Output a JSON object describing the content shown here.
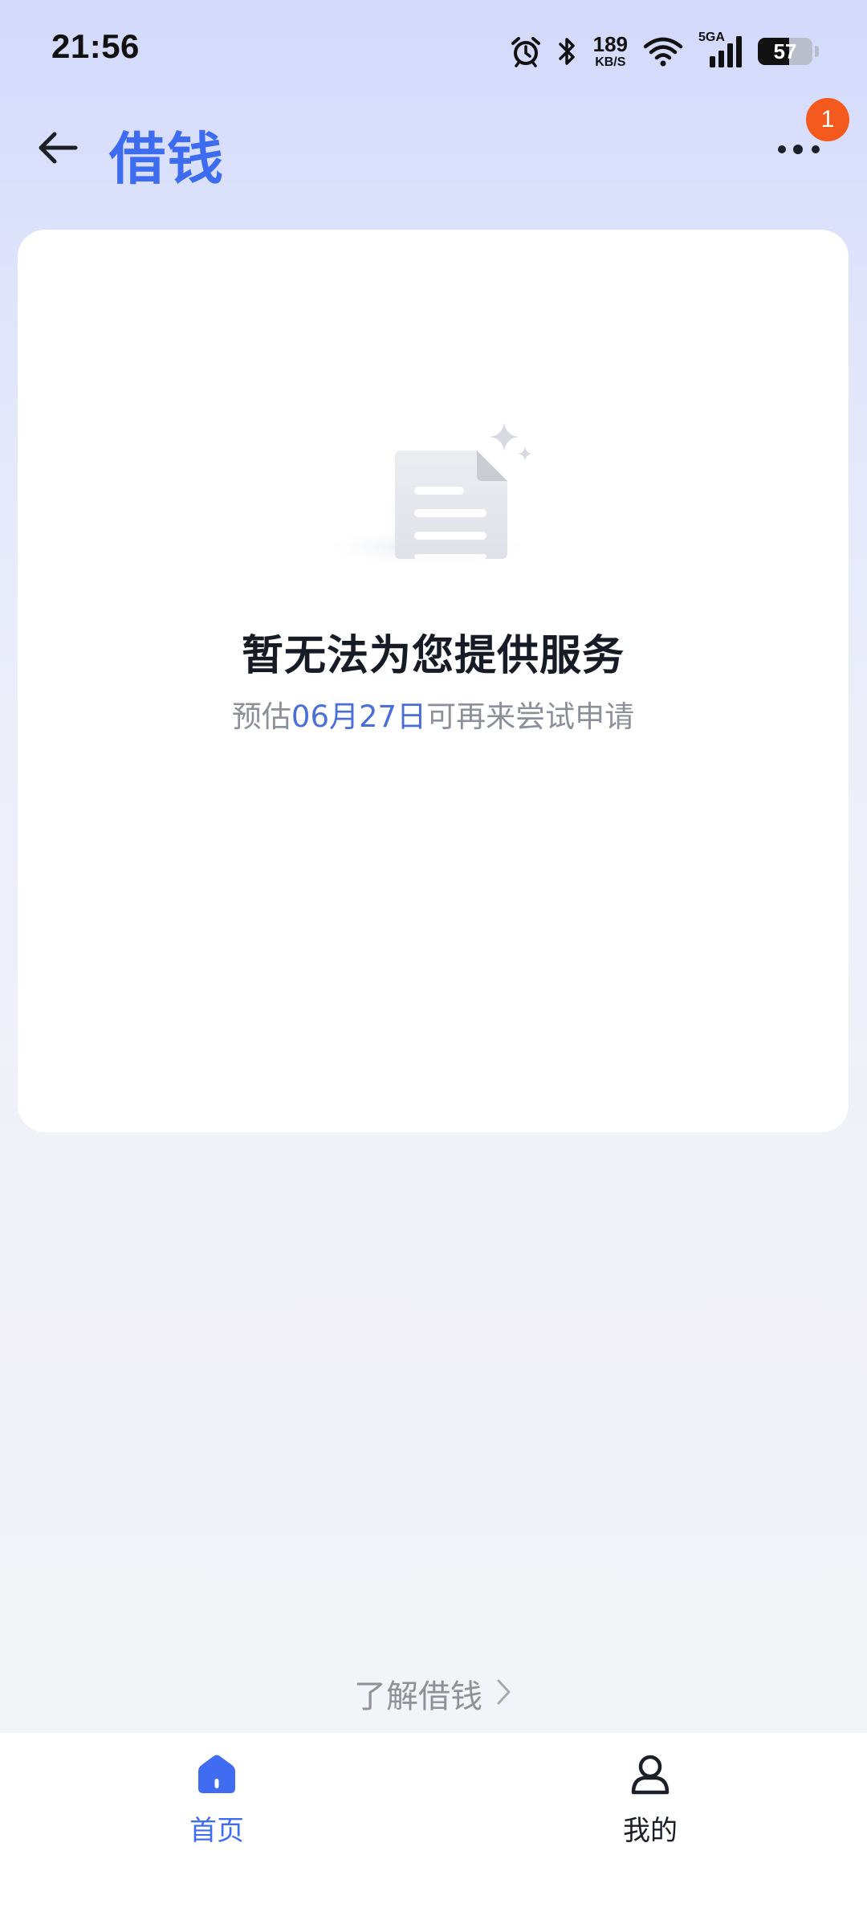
{
  "status_bar": {
    "time": "21:56",
    "net_speed_value": "189",
    "net_speed_unit": "KB/S",
    "network_type": "5GA",
    "battery_level": "57",
    "battery_fraction": 0.57,
    "icons": [
      "alarm-icon",
      "bluetooth-icon",
      "wifi-icon",
      "cellular-signal-icon",
      "battery-icon"
    ]
  },
  "header": {
    "title": "借钱",
    "back_icon": "arrow-left-icon",
    "more_icon": "more-horizontal-icon",
    "notification_count": "1"
  },
  "empty_state": {
    "illustration": "empty-document-icon",
    "title": "暂无法为您提供服务",
    "subtitle_prefix": "预估",
    "subtitle_date": "06月27日",
    "subtitle_suffix": "可再来尝试申请"
  },
  "learn_more": {
    "label": "了解借钱",
    "icon": "chevron-right-icon"
  },
  "bottom_nav": {
    "items": [
      {
        "label": "首页",
        "icon": "home-icon",
        "active": true
      },
      {
        "label": "我的",
        "icon": "user-icon",
        "active": false
      }
    ]
  },
  "colors": {
    "accent": "#3e6cf0",
    "badge": "#f45a1d",
    "date_highlight": "#4a6fd6",
    "muted_text": "#8d909a"
  }
}
